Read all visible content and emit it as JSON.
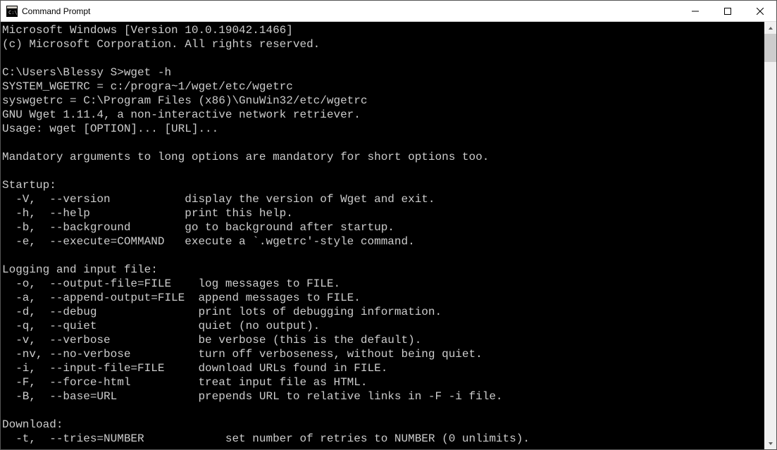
{
  "window": {
    "title": "Command Prompt"
  },
  "lines": {
    "l0": "Microsoft Windows [Version 10.0.19042.1466]",
    "l1": "(c) Microsoft Corporation. All rights reserved.",
    "l2": "",
    "l3": "C:\\Users\\Blessy S>wget -h",
    "l4": "SYSTEM_WGETRC = c:/progra~1/wget/etc/wgetrc",
    "l5": "syswgetrc = C:\\Program Files (x86)\\GnuWin32/etc/wgetrc",
    "l6": "GNU Wget 1.11.4, a non-interactive network retriever.",
    "l7": "Usage: wget [OPTION]... [URL]...",
    "l8": "",
    "l9": "Mandatory arguments to long options are mandatory for short options too.",
    "l10": "",
    "l11": "Startup:",
    "l12": "  -V,  --version           display the version of Wget and exit.",
    "l13": "  -h,  --help              print this help.",
    "l14": "  -b,  --background        go to background after startup.",
    "l15": "  -e,  --execute=COMMAND   execute a `.wgetrc'-style command.",
    "l16": "",
    "l17": "Logging and input file:",
    "l18": "  -o,  --output-file=FILE    log messages to FILE.",
    "l19": "  -a,  --append-output=FILE  append messages to FILE.",
    "l20": "  -d,  --debug               print lots of debugging information.",
    "l21": "  -q,  --quiet               quiet (no output).",
    "l22": "  -v,  --verbose             be verbose (this is the default).",
    "l23": "  -nv, --no-verbose          turn off verboseness, without being quiet.",
    "l24": "  -i,  --input-file=FILE     download URLs found in FILE.",
    "l25": "  -F,  --force-html          treat input file as HTML.",
    "l26": "  -B,  --base=URL            prepends URL to relative links in -F -i file.",
    "l27": "",
    "l28": "Download:",
    "l29": "  -t,  --tries=NUMBER            set number of retries to NUMBER (0 unlimits)."
  }
}
